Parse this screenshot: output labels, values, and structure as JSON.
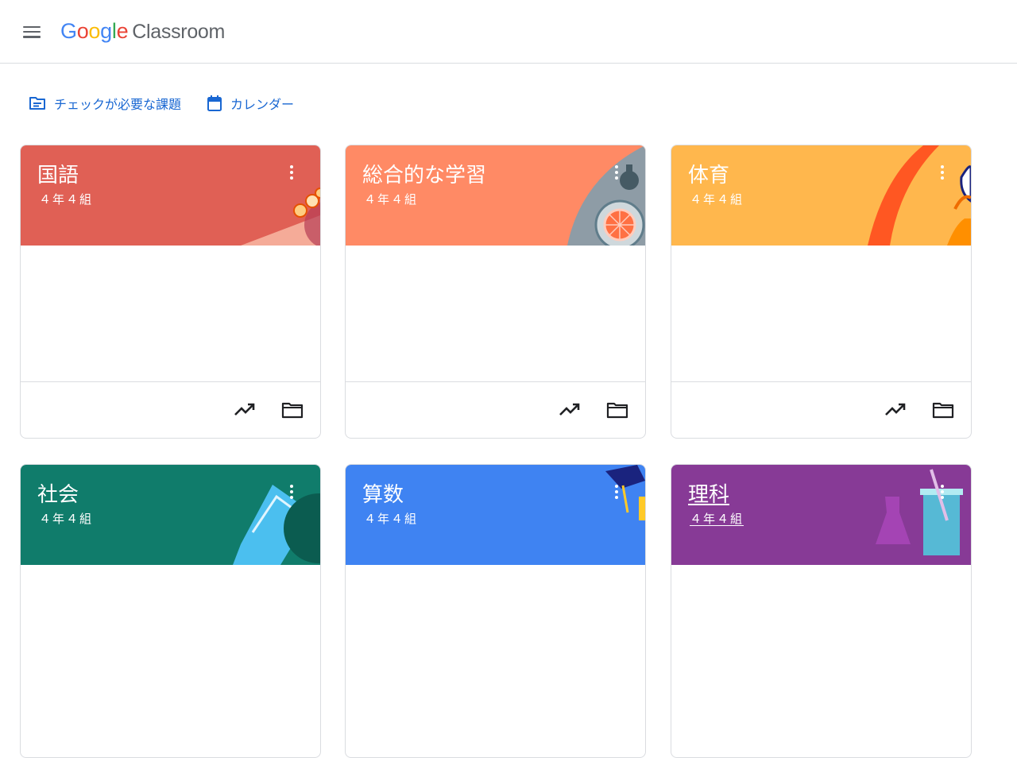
{
  "header": {
    "logo_letters": [
      {
        "ch": "G",
        "color": "#4285f4"
      },
      {
        "ch": "o",
        "color": "#ea4335"
      },
      {
        "ch": "o",
        "color": "#fbbc05"
      },
      {
        "ch": "g",
        "color": "#4285f4"
      },
      {
        "ch": "l",
        "color": "#34a853"
      },
      {
        "ch": "e",
        "color": "#ea4335"
      }
    ],
    "product_name": "Classroom",
    "menu_icon": "hamburger-menu-icon"
  },
  "quick_links": {
    "todo_label": "チェックが必要な課題",
    "todo_icon": "assignment-list-icon",
    "calendar_label": "カレンダー",
    "calendar_icon": "calendar-icon",
    "color": "#1967d2"
  },
  "classes": [
    {
      "title": "国語",
      "section": "４年４組",
      "color": "#e06055",
      "theme": "language"
    },
    {
      "title": "総合的な学習",
      "section": "４年４組",
      "color": "#ff8a65",
      "theme": "science-equipment"
    },
    {
      "title": "体育",
      "section": "４年４組",
      "color": "#ffb74d",
      "theme": "sports"
    },
    {
      "title": "社会",
      "section": "４年４組",
      "color": "#107c6b",
      "theme": "map"
    },
    {
      "title": "算数",
      "section": "４年４組",
      "color": "#3f83f2",
      "theme": "graduation"
    },
    {
      "title": "理科",
      "section": "４年４組",
      "color": "#873a96",
      "theme": "lab"
    }
  ],
  "card_footer_icons": [
    "trending-up-icon",
    "folder-icon"
  ]
}
